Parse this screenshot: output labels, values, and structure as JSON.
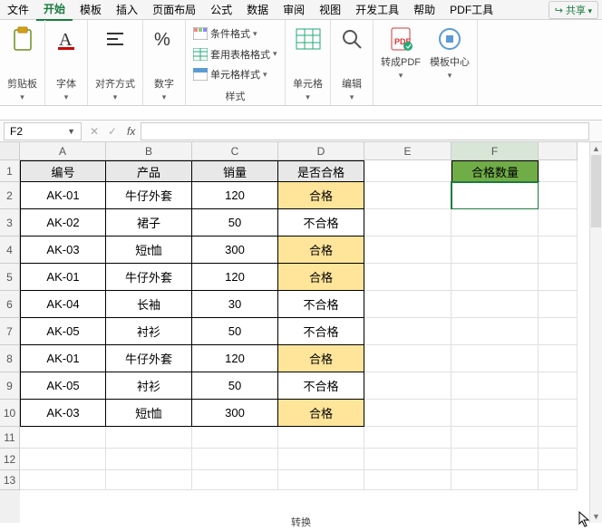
{
  "menu": {
    "items": [
      "文件",
      "开始",
      "模板",
      "插入",
      "页面布局",
      "公式",
      "数据",
      "审阅",
      "视图",
      "开发工具",
      "帮助",
      "PDF工具"
    ],
    "active_index": 1,
    "share": "共享"
  },
  "ribbon": {
    "clipboard": {
      "label": "剪贴板"
    },
    "font": {
      "label": "字体"
    },
    "align": {
      "label": "对齐方式"
    },
    "number": {
      "label": "数字"
    },
    "styles": {
      "cond": "条件格式",
      "tablefmt": "套用表格格式",
      "cellfmt": "单元格样式",
      "label": "样式"
    },
    "cells": {
      "label": "单元格"
    },
    "editing": {
      "label": "编辑"
    },
    "convert_group": {
      "convertpdf": "转成PDF",
      "tplcenter": "模板中心",
      "label": "转换"
    }
  },
  "namebox": "F2",
  "fx": "fx",
  "columns": [
    "A",
    "B",
    "C",
    "D",
    "E",
    "F"
  ],
  "rows": [
    "1",
    "2",
    "3",
    "4",
    "5",
    "6",
    "7",
    "8",
    "9",
    "10",
    "11",
    "12",
    "13"
  ],
  "table": {
    "headers": [
      "编号",
      "产品",
      "销量",
      "是否合格"
    ],
    "rows": [
      {
        "id": "AK-01",
        "product": "牛仔外套",
        "sales": "120",
        "status": "合格",
        "pass": true
      },
      {
        "id": "AK-02",
        "product": "裙子",
        "sales": "50",
        "status": "不合格",
        "pass": false
      },
      {
        "id": "AK-03",
        "product": "短t恤",
        "sales": "300",
        "status": "合格",
        "pass": true
      },
      {
        "id": "AK-01",
        "product": "牛仔外套",
        "sales": "120",
        "status": "合格",
        "pass": true
      },
      {
        "id": "AK-04",
        "product": "长袖",
        "sales": "30",
        "status": "不合格",
        "pass": false
      },
      {
        "id": "AK-05",
        "product": "衬衫",
        "sales": "50",
        "status": "不合格",
        "pass": false
      },
      {
        "id": "AK-01",
        "product": "牛仔外套",
        "sales": "120",
        "status": "合格",
        "pass": true
      },
      {
        "id": "AK-05",
        "product": "衬衫",
        "sales": "50",
        "status": "不合格",
        "pass": false
      },
      {
        "id": "AK-03",
        "product": "短t恤",
        "sales": "300",
        "status": "合格",
        "pass": true
      }
    ]
  },
  "f_header": "合格数量"
}
